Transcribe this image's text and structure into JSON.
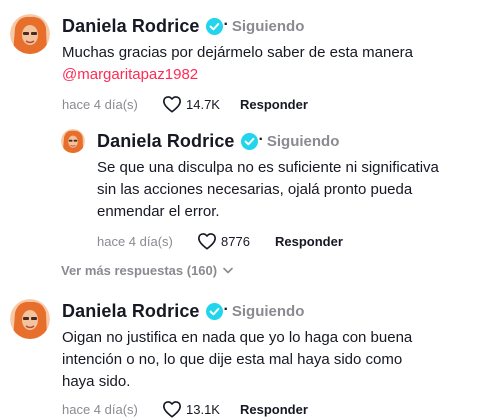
{
  "comments": [
    {
      "username": "Daniela Rodrice",
      "following": "Siguiendo",
      "text": "Muchas gracias por dejármelo saber de esta manera",
      "mention": "@margaritapaz1982",
      "time": "hace 4 día(s)",
      "likes": "14.7K",
      "reply": "Responder"
    },
    {
      "username": "Daniela Rodrice",
      "following": "Siguiendo",
      "text_lines": [
        "Se que una disculpa no es suficiente ni significativa",
        "sin las acciones necesarias, ojalá pronto pueda",
        "enmendar el error."
      ],
      "time": "hace 4 día(s)",
      "likes": "8776",
      "reply": "Responder"
    },
    {
      "username": "Daniela Rodrice",
      "following": "Siguiendo",
      "text_lines": [
        "Oigan no justifica en nada que yo lo haga con buena",
        "intención o no, lo que dije esta mal haya sido como",
        "haya sido."
      ],
      "time": "hace 4 día(s)",
      "likes": "13.1K",
      "reply": "Responder"
    }
  ],
  "more_replies": "Ver más respuestas (160)",
  "colors": {
    "accent": "#fe2c55",
    "verified": "#20d5ec",
    "muted": "#8a8b91",
    "text": "#161823"
  },
  "icons": {
    "verified": "verified-check-icon",
    "like": "heart-outline-icon",
    "expand": "chevron-down-icon"
  }
}
